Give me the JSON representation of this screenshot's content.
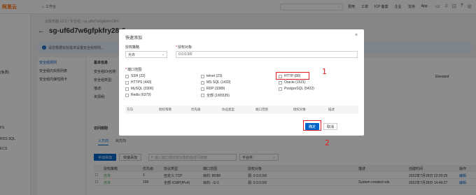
{
  "topbar": {
    "logo": "阿里云",
    "workspace": "工作台",
    "nav": [
      "费用",
      "工单",
      "ICP 备案",
      "企业",
      "支持",
      "App"
    ]
  },
  "sidebar": {
    "items": [
      "(免费)",
      "FS",
      "RDS SQL",
      "ECS"
    ]
  },
  "page": {
    "breadcrumb": "云服务器 ECS / 安全组 / sg-uf6d7w6gfpkfry28r6",
    "title": "sg-uf6d7w6gfpkfry28r6",
    "notice": "请您根据实际需求设置安全组规则...",
    "subnav": [
      "安全组规则",
      "安全组内实例列表",
      "安全组内弹性网卡"
    ],
    "basic_info_label": "基本信息",
    "info_labels": [
      "安全组ID/名称:",
      "安全组类型:",
      "描述:",
      "资源组:"
    ],
    "info_right": "Elevated",
    "rules_section": "访问规则",
    "tabs": [
      "入方向",
      "出方向"
    ],
    "btn_manual": "手动添加",
    "btn_quick": "快速添加",
    "search_placeholder": "输入端口或授权对象的值进行搜索",
    "filter_select": "不合并",
    "rules_headers": [
      "授权策略",
      "优先级",
      "协议类型",
      "端口范围",
      "授权对象",
      "描述",
      "创建时间",
      "操作"
    ],
    "rules_rows": [
      [
        "允许",
        "1",
        "自定义 TCP",
        "目的: 80/80",
        "源: 0.0.0.0/0",
        "",
        "2022年7月28日 22:00:25",
        "编辑"
      ],
      [
        "允许",
        "100",
        "全部 ICMP(IPv4)",
        "目的: -1/-1",
        "源: 0.0.0.0/0",
        "System created rule.",
        "2022年7月28日 14:46:27",
        "编辑"
      ]
    ]
  },
  "modal": {
    "title": "快速添加",
    "policy_label": "授权策略",
    "policy_value": "允许",
    "target_label": "授权对象:",
    "target_value": "0.0.0.0/0",
    "port_label": "端口范围:",
    "ports": [
      [
        "SSH (22)",
        "telnet (23)",
        "HTTP (80)"
      ],
      [
        "HTTPS (443)",
        "MS SQL (1433)",
        "Oracle (1521)"
      ],
      [
        "MySQL (3306)",
        "RDP (3389)",
        "PostgreSQL (5432)"
      ],
      [
        "Redis (6379)",
        "全部 (1/65535)",
        ""
      ]
    ],
    "table_headers": [
      "方向",
      "授权策略",
      "优先级",
      "协议类型",
      "端口范围",
      "授权对象",
      "描述"
    ],
    "confirm": "确定",
    "cancel": "取消"
  },
  "annotations": {
    "one": "1",
    "two": "2"
  },
  "colors": {
    "primary": "#0064c8",
    "accent": "#ff6a00",
    "annotation": "#e02020"
  }
}
